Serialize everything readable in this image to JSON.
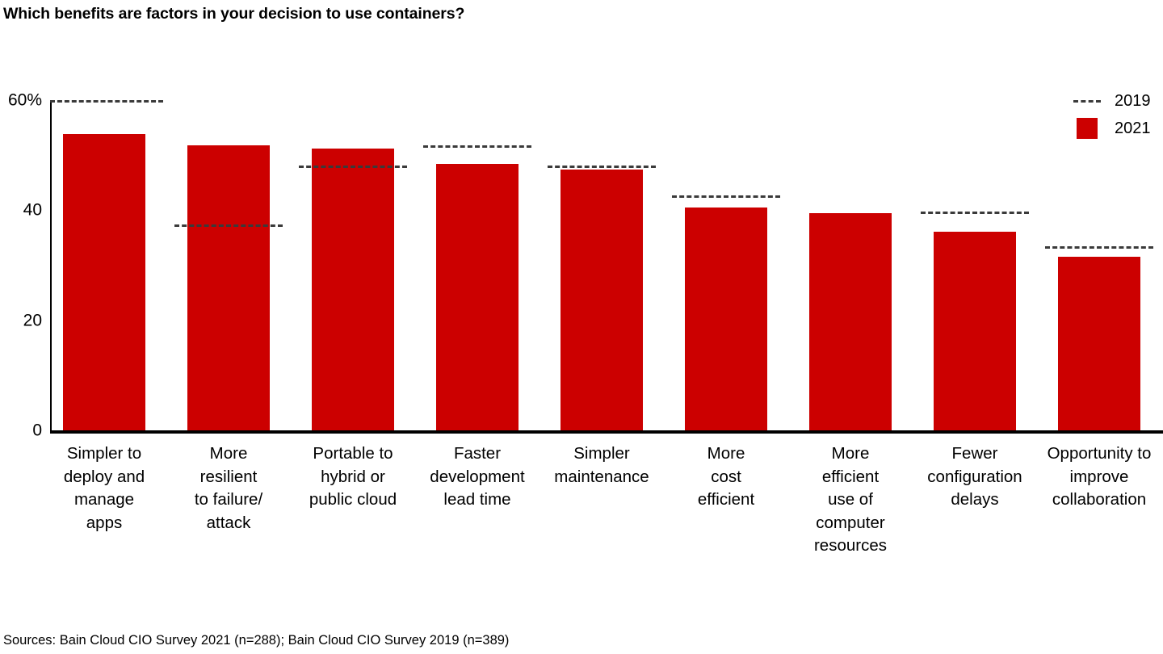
{
  "chart_data": {
    "type": "bar",
    "title": "Which benefits are factors in your decision to use containers?",
    "xlabel": "",
    "ylabel": "",
    "ylim": [
      0,
      60
    ],
    "yticks": [
      "0",
      "20",
      "40",
      "60%"
    ],
    "ytick_values": [
      0,
      20,
      40,
      60
    ],
    "grid": "dashed gridline at 60% only",
    "legend_position": "top-right",
    "categories": [
      "Simpler to deploy and manage apps",
      "More resilient to failure/ attack",
      "Portable to hybrid or public cloud",
      "Faster development lead time",
      "Simpler maintenance",
      "More cost efficient",
      "More efficient use of computer resources",
      "Fewer configuration delays",
      "Opportunity to improve collaboration"
    ],
    "category_lines": [
      [
        "Simpler to",
        "deploy and",
        "manage",
        "apps"
      ],
      [
        "More",
        "resilient",
        "to failure/",
        "attack"
      ],
      [
        "Portable to",
        "hybrid or",
        "public cloud"
      ],
      [
        "Faster",
        "development",
        "lead time"
      ],
      [
        "Simpler",
        "maintenance"
      ],
      [
        "More",
        "cost",
        "efficient"
      ],
      [
        "More",
        "efficient",
        "use of",
        "computer",
        "resources"
      ],
      [
        "Fewer",
        "configuration",
        "delays"
      ],
      [
        "Opportunity to",
        "improve",
        "collaboration"
      ]
    ],
    "series": [
      {
        "name": "2021",
        "style": "bar",
        "color": "#cc0000",
        "values": [
          53.8,
          51.8,
          51.2,
          48.4,
          47.4,
          40.5,
          39.4,
          36.1,
          31.5
        ]
      },
      {
        "name": "2019",
        "style": "dashed-line-marker",
        "color": "#3a3a3a",
        "values": [
          null,
          37.4,
          48.1,
          51.8,
          48.1,
          42.7,
          null,
          39.7,
          33.4
        ]
      }
    ]
  },
  "legend": {
    "items": [
      {
        "label": "2019",
        "swatch": "dashed-line"
      },
      {
        "label": "2021",
        "swatch": "red-square"
      }
    ]
  },
  "source": {
    "text": "Sources: Bain Cloud CIO Survey 2021 (n=288); Bain Cloud CIO Survey 2019 (n=389)"
  },
  "colors": {
    "bar_red": "#cc0000",
    "reference_dash": "#3a3a3a",
    "axis": "#000000"
  }
}
